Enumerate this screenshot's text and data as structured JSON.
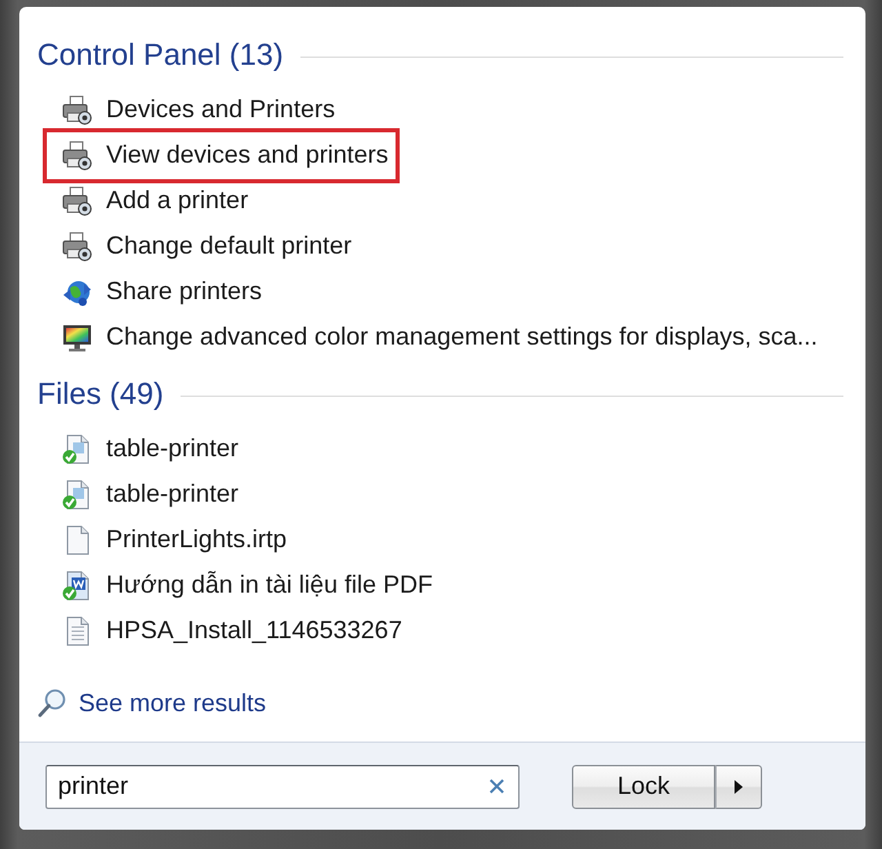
{
  "sections": [
    {
      "heading": "Control Panel (13)",
      "items": [
        {
          "label": "Devices and Printers",
          "kind": "printer",
          "highlighted": false
        },
        {
          "label": "View devices and printers",
          "kind": "printer",
          "highlighted": true
        },
        {
          "label": "Add a printer",
          "kind": "printer",
          "highlighted": false
        },
        {
          "label": "Change default printer",
          "kind": "printer",
          "highlighted": false
        },
        {
          "label": "Share printers",
          "kind": "network",
          "highlighted": false
        },
        {
          "label": "Change advanced color management settings for displays, sca...",
          "kind": "monitor",
          "highlighted": false
        }
      ]
    },
    {
      "heading": "Files (49)",
      "items": [
        {
          "label": "table-printer",
          "kind": "shared-document",
          "highlighted": false
        },
        {
          "label": "table-printer",
          "kind": "shared-document",
          "highlighted": false
        },
        {
          "label": "PrinterLights.irtp",
          "kind": "blank-document",
          "highlighted": false
        },
        {
          "label": "Hướng dẫn in tài liệu file PDF",
          "kind": "shared-word-document",
          "highlighted": false
        },
        {
          "label": "HPSA_Install_1146533267",
          "kind": "text-document",
          "highlighted": false
        }
      ]
    }
  ],
  "see_more": {
    "label": "See more results"
  },
  "search": {
    "value": "printer"
  },
  "power_button": {
    "label": "Lock"
  }
}
